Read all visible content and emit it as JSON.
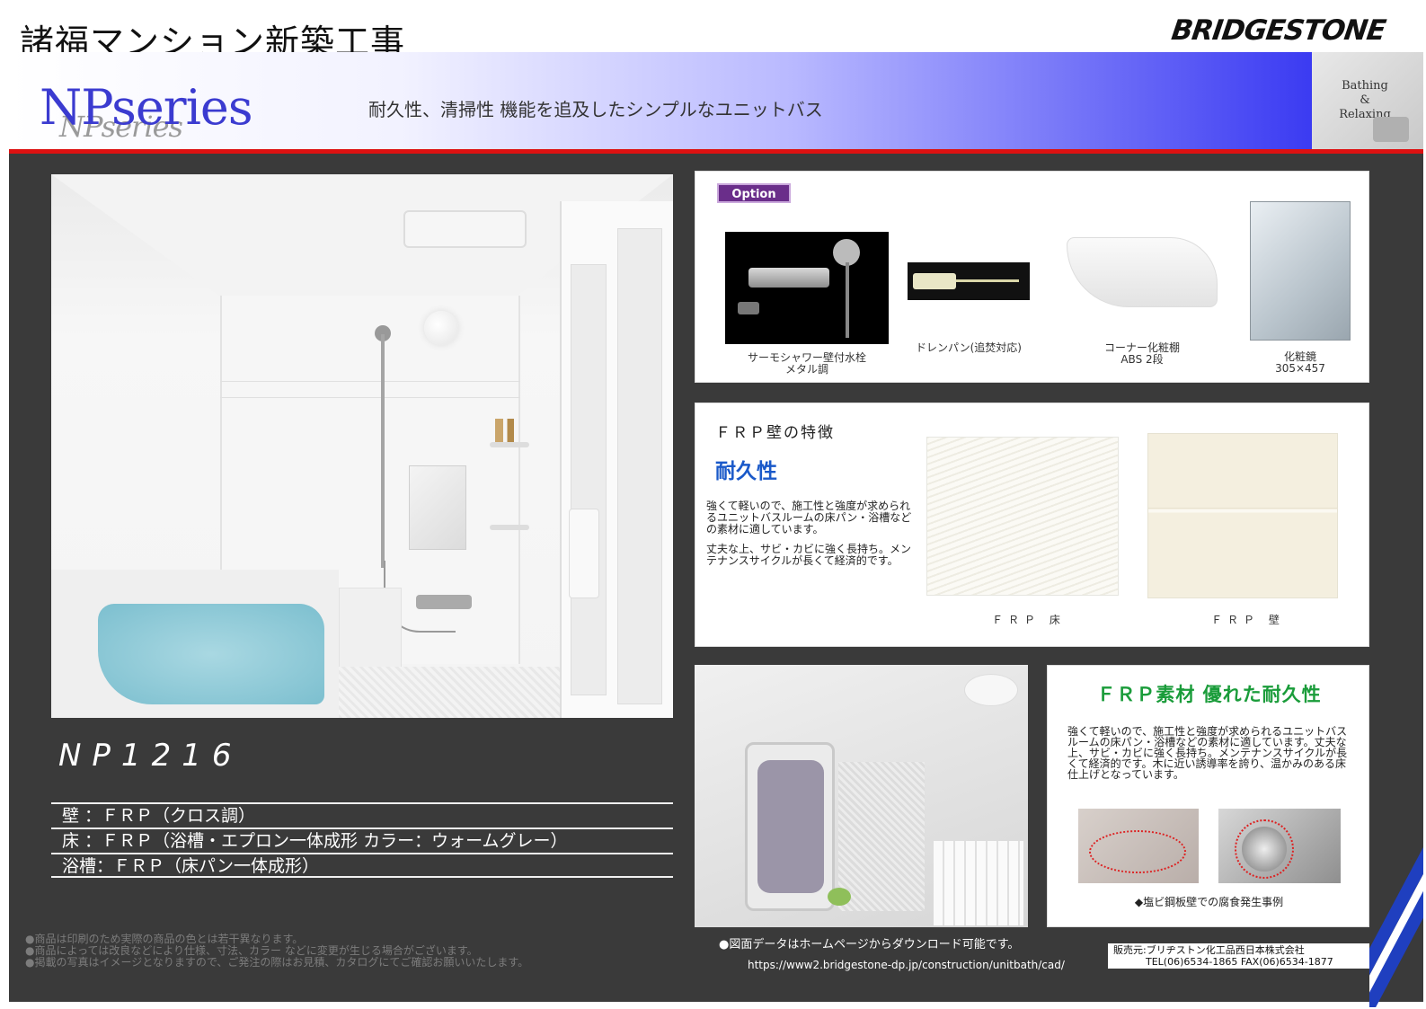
{
  "header": {
    "title": "諸福マンション新築工事",
    "brand": "BRIDGESTONE"
  },
  "banner": {
    "series_logo": "NPseries",
    "series_shadow": "NPseries",
    "tagline": "耐久性、清掃性 機能を追及したシンプルなユニットバス",
    "corner_lines": [
      "Bathing",
      "&",
      "Relaxing"
    ]
  },
  "product": {
    "model": "NP1216",
    "specs": [
      "壁 ：ＦＲＰ（クロス調）",
      "床 ：ＦＲＰ（浴槽・エプロン一体成形 カラー：ウォームグレー）",
      "浴槽：ＦＲＰ（床パン一体成形）"
    ]
  },
  "disclaimer": [
    "●商品は印刷のため実際の商品の色とは若干異なります。",
    "●商品によっては改良などにより仕様、寸法、カラー などに変更が生じる場合がございます。",
    "●掲載の写真はイメージとなりますので、ご発注の際はお見積、カタログにてご確認お願いいたします。"
  ],
  "option": {
    "badge": "Option",
    "items": [
      {
        "name": "サーモシャワー壁付水栓",
        "sub": "メタル調"
      },
      {
        "name": "ドレンパン(追焚対応)",
        "sub": ""
      },
      {
        "name": "コーナー化粧棚",
        "sub": "ABS 2段"
      },
      {
        "name": "化粧鏡",
        "sub": "305×457"
      }
    ]
  },
  "frp": {
    "title": "ＦＲＰ壁の特徴",
    "subtitle": "耐久性",
    "body": [
      "強くて軽いので、施工性と強度が求められるユニットバスルームの床パン・浴槽などの素材に適しています。",
      "丈夫な上、サビ・カビに強く長持ち。メンテナンスサイクルが長くて経済的です。"
    ],
    "floor_caption": "ＦＲＰ 床",
    "wall_caption": "ＦＲＰ 壁"
  },
  "durability": {
    "title": "ＦＲＰ素材 優れた耐久性",
    "body": "強くて軽いので、施工性と強度が求められるユニットバスルームの床パン・浴槽などの素材に適しています。丈夫な上、サビ・カビに強く長持ち。メンテナンスサイクルが長くて経済的です。木に近い誘導率を誇り、温かみのある床仕上げとなっています。",
    "caption": "◆塩ビ鋼板壁での腐食発生事例"
  },
  "footer": {
    "download": "●図面データはホームページからダウンロード可能です。",
    "url": "https://www2.bridgestone-dp.jp/construction/unitbath/cad/",
    "seller": "販売元:ブリヂストン化工品西日本株式会社",
    "contact": "TEL(06)6534-1865 FAX(06)6534-1877"
  },
  "colors": {
    "accent_red": "#dd1111",
    "panel": "#3a3a3a",
    "option_badge": "#6a2e8a",
    "frp_subtitle": "#1a59c9",
    "durability_title": "#1a9c3a"
  }
}
